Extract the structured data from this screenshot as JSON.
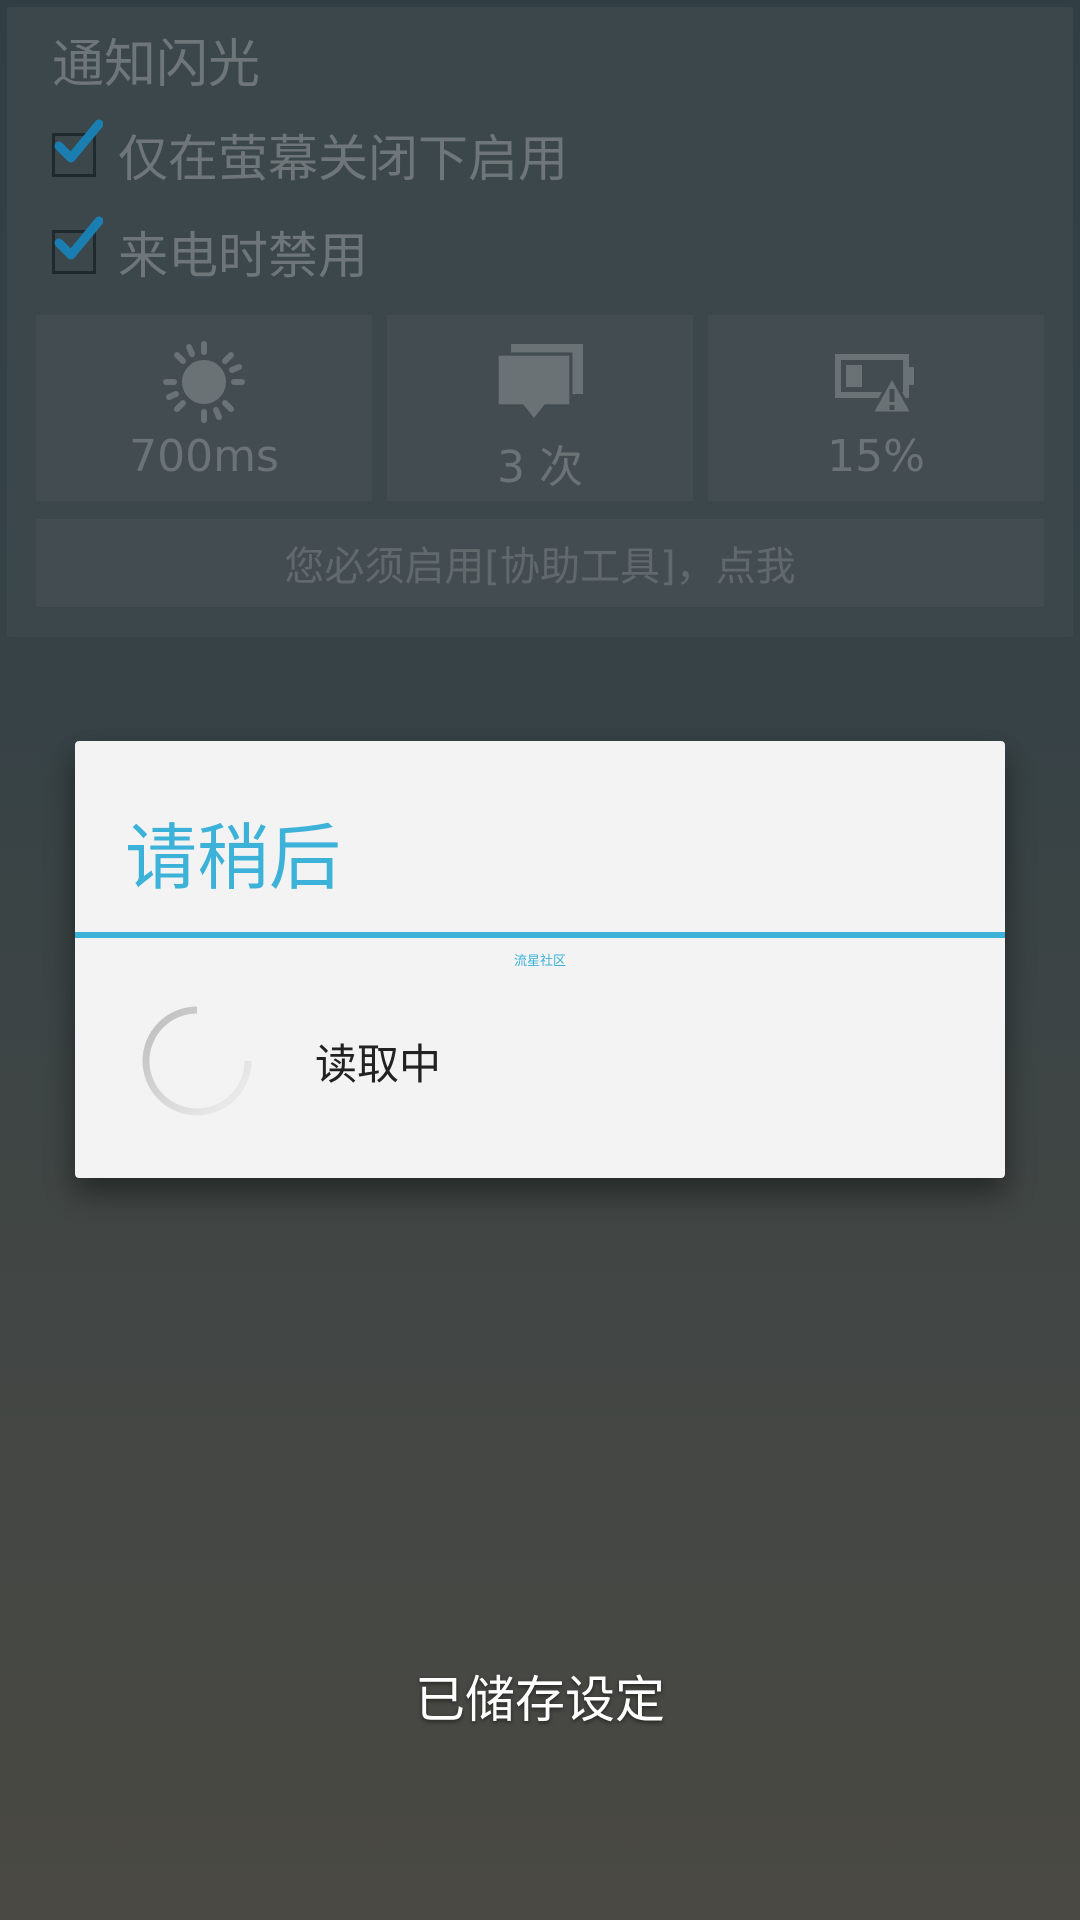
{
  "panel": {
    "title": "通知闪光",
    "options": [
      {
        "label": "仅在萤幕关闭下启用",
        "checked": true
      },
      {
        "label": "来电时禁用",
        "checked": true
      }
    ],
    "tiles": [
      {
        "icon": "brightness-icon",
        "value": "700ms"
      },
      {
        "icon": "messages-icon",
        "value": "3 次"
      },
      {
        "icon": "battery-warning-icon",
        "value": "15%"
      }
    ],
    "accessibility_button": "您必须启用[协助工具]，点我"
  },
  "dialog": {
    "title": "请稍后",
    "watermark": "流星社区",
    "message": "读取中"
  },
  "toast": "已储存设定",
  "colors": {
    "accent": "#3db2d8",
    "check": "#1a7fb0"
  }
}
